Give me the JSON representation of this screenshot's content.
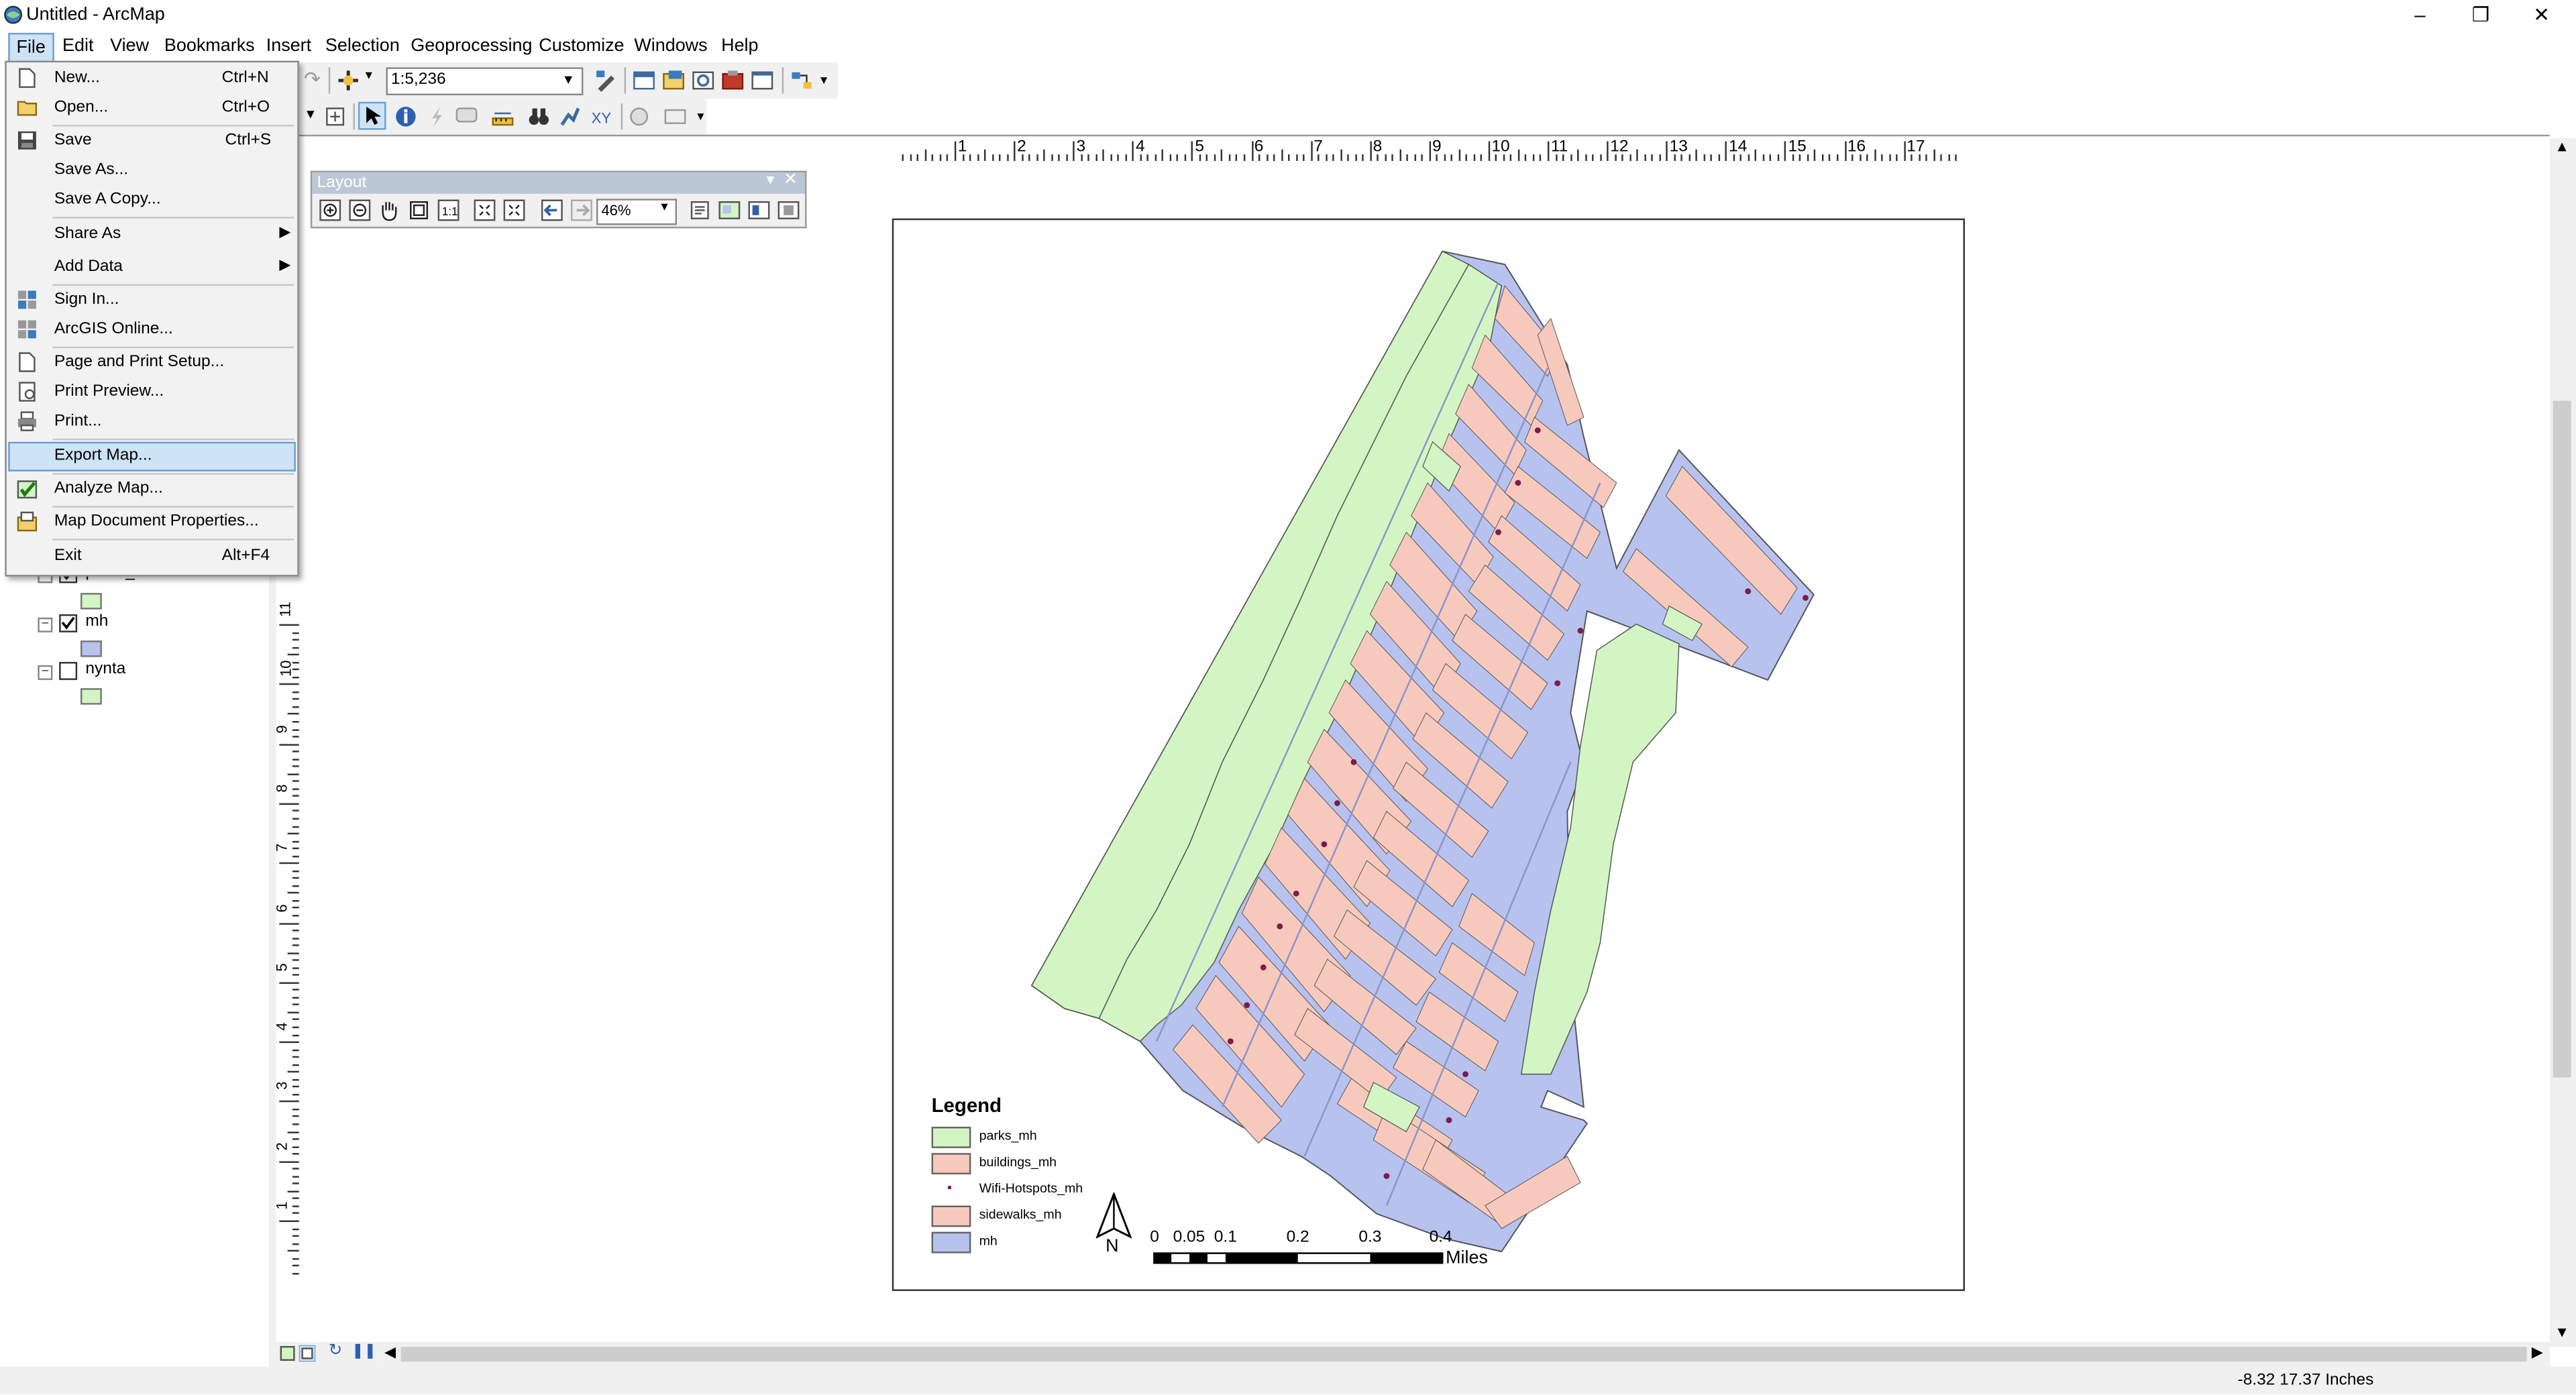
{
  "window": {
    "title": "Untitled - ArcMap"
  },
  "menubar": [
    "File",
    "Edit",
    "View",
    "Bookmarks",
    "Insert",
    "Selection",
    "Geoprocessing",
    "Customize",
    "Windows",
    "Help"
  ],
  "file_menu": {
    "items": [
      {
        "label": "New...",
        "shortcut": "Ctrl+N",
        "icon": "new-document-icon"
      },
      {
        "label": "Open...",
        "shortcut": "Ctrl+O",
        "icon": "open-folder-icon"
      },
      {
        "label": "Save",
        "shortcut": "Ctrl+S",
        "icon": "save-icon"
      },
      {
        "label": "Save As...",
        "shortcut": "",
        "icon": ""
      },
      {
        "label": "Save A Copy...",
        "shortcut": "",
        "icon": ""
      },
      {
        "label": "Share As",
        "shortcut": "",
        "icon": "",
        "submenu": true
      },
      {
        "label": "Add Data",
        "shortcut": "",
        "icon": "",
        "submenu": true
      },
      {
        "label": "Sign In...",
        "shortcut": "",
        "icon": "arcgis-signin-icon"
      },
      {
        "label": "ArcGIS Online...",
        "shortcut": "",
        "icon": "arcgis-online-icon"
      },
      {
        "label": "Page and Print Setup...",
        "shortcut": "",
        "icon": "page-setup-icon"
      },
      {
        "label": "Print Preview...",
        "shortcut": "",
        "icon": "print-preview-icon"
      },
      {
        "label": "Print...",
        "shortcut": "",
        "icon": "printer-icon"
      },
      {
        "label": "Export Map...",
        "shortcut": "",
        "icon": "",
        "highlighted": true
      },
      {
        "label": "Analyze Map...",
        "shortcut": "",
        "icon": "analyze-map-icon"
      },
      {
        "label": "Map Document Properties...",
        "shortcut": "",
        "icon": "document-properties-icon"
      },
      {
        "label": "Exit",
        "shortcut": "Alt+F4",
        "icon": ""
      }
    ]
  },
  "toolbar": {
    "scale": "1:5,236"
  },
  "layout_toolbar": {
    "title": "Layout",
    "zoom": "46%"
  },
  "toc": {
    "layers": [
      {
        "name": "parks_mh",
        "checked": true,
        "swatch": "#d3f5c4"
      },
      {
        "name": "mh",
        "checked": true,
        "swatch": "#b8c2ef"
      },
      {
        "name": "nynta",
        "checked": false,
        "swatch": "#d3f5c4"
      }
    ]
  },
  "ruler": {
    "h_labels": [
      "1",
      "2",
      "3",
      "4",
      "5",
      "6",
      "7",
      "8",
      "9",
      "10",
      "11",
      "12",
      "13",
      "14",
      "15",
      "16",
      "17"
    ],
    "v_labels": [
      "11",
      "10",
      "9",
      "8",
      "7",
      "6",
      "5",
      "4",
      "3",
      "2",
      "1"
    ]
  },
  "map": {
    "legend_title": "Legend",
    "legend": [
      {
        "label": "parks_mh",
        "color": "#d3f5c4"
      },
      {
        "label": "buildings_mh",
        "color": "#f7c9bd"
      },
      {
        "label": "Wifi-Hotspots_mh",
        "color": "#7a1d4a",
        "point": true
      },
      {
        "label": "sidewalks_mh",
        "color": "#f7c9bd"
      },
      {
        "label": "mh",
        "color": "#b8c2ef"
      }
    ],
    "north_label": "N",
    "scalebar": {
      "ticks": [
        "0",
        "0.05",
        "0.1",
        "0.2",
        "0.3",
        "0.4"
      ],
      "unit": "Miles"
    }
  },
  "colors": {
    "water": "#b8c2ef",
    "park": "#d3f5c4",
    "building": "#f7c9bd",
    "hotspot": "#7a1d4a",
    "menu_highlight": "#cde3f6"
  },
  "status": {
    "coords": "-8.32  17.37 Inches"
  }
}
